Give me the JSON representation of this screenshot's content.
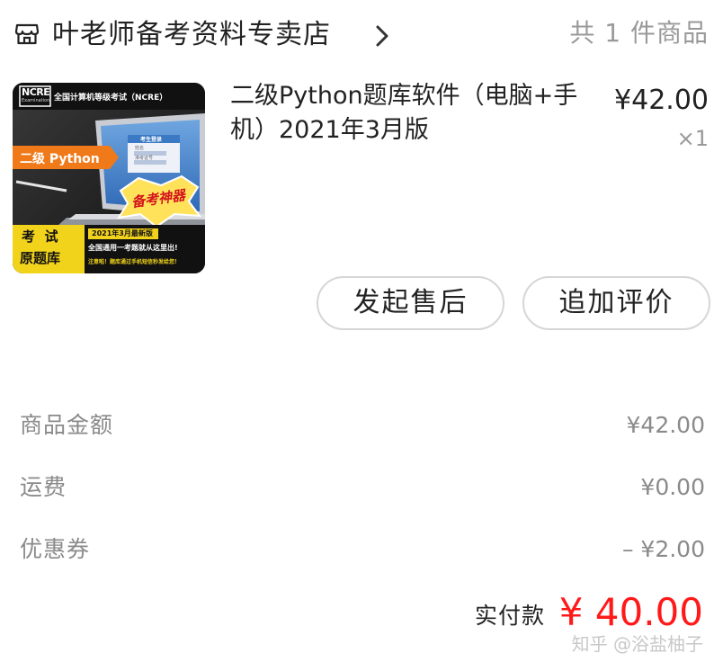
{
  "shop": {
    "name": "叶老师备考资料专卖店",
    "item_count": "共 1 件商品"
  },
  "product": {
    "title": "二级Python题库软件（电脑+手机）2021年3月版",
    "price": "¥42.00",
    "quantity": "×1",
    "thumbnail": {
      "logo": "NCRE",
      "logo_sub": "Examination",
      "header": "全国计算机等级考试（NCRE）",
      "level_label": "二级 Python",
      "screen_title": "考生登录",
      "screen_field1": "姓名",
      "screen_field2": "准考证号",
      "stamp": "备考神器",
      "left_block_line1": "考  试",
      "left_block_line2": "原题库",
      "edition": "2021年3月最新版",
      "tagline": "全国通用一考题就从这里出!",
      "notice": "注意啦！题库通过手机短信秒发给您！"
    }
  },
  "actions": {
    "after_sale": "发起售后",
    "review": "追加评价"
  },
  "summary": {
    "goods_amount_label": "商品金额",
    "goods_amount_value": "¥42.00",
    "shipping_label": "运费",
    "shipping_value": "¥0.00",
    "coupon_label": "优惠券",
    "coupon_value": "– ¥2.00",
    "paid_label": "实付款",
    "paid_value": "¥ 40.00"
  },
  "watermark": "知乎 @浴盐柚子",
  "colors": {
    "accent_red": "#ff1a1a",
    "muted_text": "#8a8a8a",
    "thumb_yellow": "#ffd21a",
    "thumb_orange": "#f07a1a"
  }
}
